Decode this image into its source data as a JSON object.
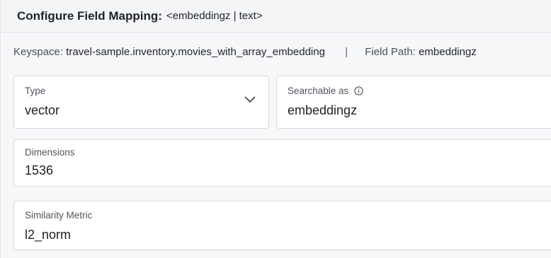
{
  "header": {
    "title": "Configure Field Mapping:",
    "subtitle": "<embeddingz | text>"
  },
  "info": {
    "keyspace_label": "Keyspace:",
    "keyspace_value": "travel-sample.inventory.movies_with_array_embedding",
    "separator": "|",
    "field_path_label": "Field Path:",
    "field_path_value": "embeddingz"
  },
  "type_field": {
    "label": "Type",
    "value": "vector",
    "icon": "chevron-down-icon"
  },
  "searchable_field": {
    "label": "Searchable as",
    "value": "embeddingz",
    "icon": "info-icon"
  },
  "dimensions_field": {
    "label": "Dimensions",
    "value": "1536"
  },
  "similarity_field": {
    "label": "Similarity Metric",
    "value": "l2_norm"
  }
}
